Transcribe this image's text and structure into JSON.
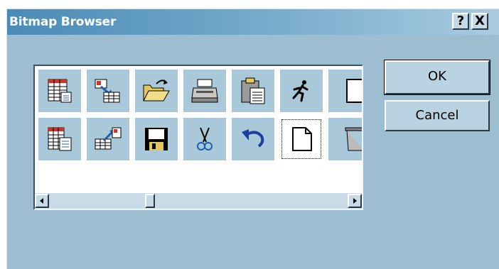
{
  "window": {
    "title": "Bitmap Browser",
    "help_label": "?",
    "close_label": "X"
  },
  "buttons": {
    "ok_label": "OK",
    "cancel_label": "Cancel"
  },
  "bitmaps": {
    "row1": [
      "spreadsheet-icon",
      "import-data-icon",
      "open-folder-icon",
      "printer-icon",
      "paste-clipboard-icon",
      "run-icon",
      "partial-page-icon"
    ],
    "row2": [
      "spreadsheet-alt-icon",
      "export-data-icon",
      "save-disk-icon",
      "cut-scissors-icon",
      "undo-arrow-icon",
      "new-page-icon",
      "delete-trash-icon"
    ],
    "selected": "new-page-icon"
  },
  "colors": {
    "window_bg": "#9dbdd0",
    "cell_bg": "#a9c9da",
    "titlebar_start": "#4a8bb6"
  }
}
